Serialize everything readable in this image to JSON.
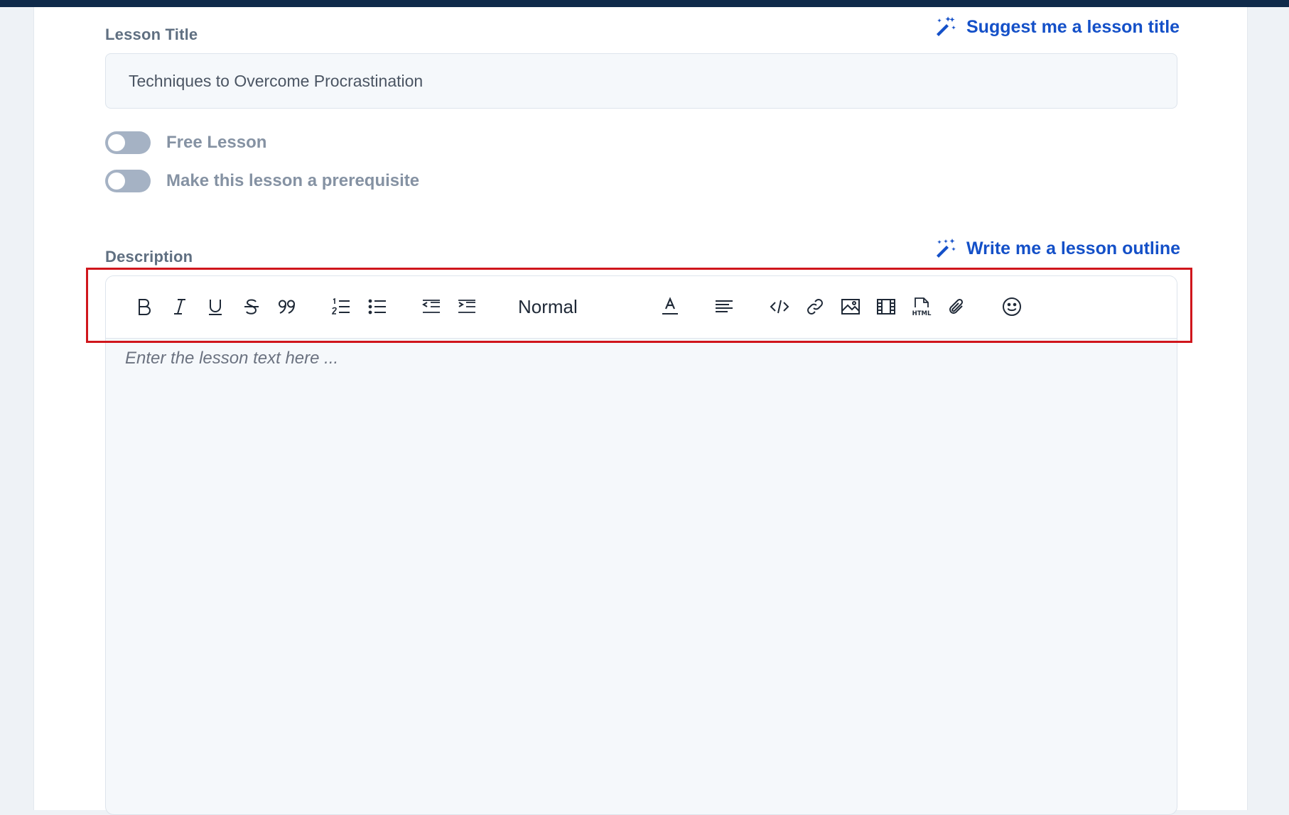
{
  "lesson_title": {
    "label": "Lesson Title",
    "value": "Techniques to Overcome Procrastination",
    "ai_link": "Suggest me a lesson title"
  },
  "toggles": [
    {
      "label": "Free Lesson",
      "on": false
    },
    {
      "label": "Make this lesson a prerequisite",
      "on": false
    }
  ],
  "description": {
    "label": "Description",
    "ai_link": "Write me a lesson outline",
    "placeholder": "Enter the lesson text here ...",
    "format_select": "Normal",
    "toolbar_icons": [
      "bold-icon",
      "italic-icon",
      "underline-icon",
      "strikethrough-icon",
      "blockquote-icon",
      "ordered-list-icon",
      "bullet-list-icon",
      "outdent-icon",
      "indent-icon",
      "text-color-icon",
      "align-icon",
      "code-icon",
      "link-icon",
      "image-icon",
      "video-icon",
      "html-icon",
      "attachment-icon",
      "emoji-icon"
    ]
  },
  "colors": {
    "accent": "#1450c8",
    "highlight": "#d0161c",
    "top_bar": "#0f2a4a",
    "toggle_off": "#a5b2c4"
  }
}
